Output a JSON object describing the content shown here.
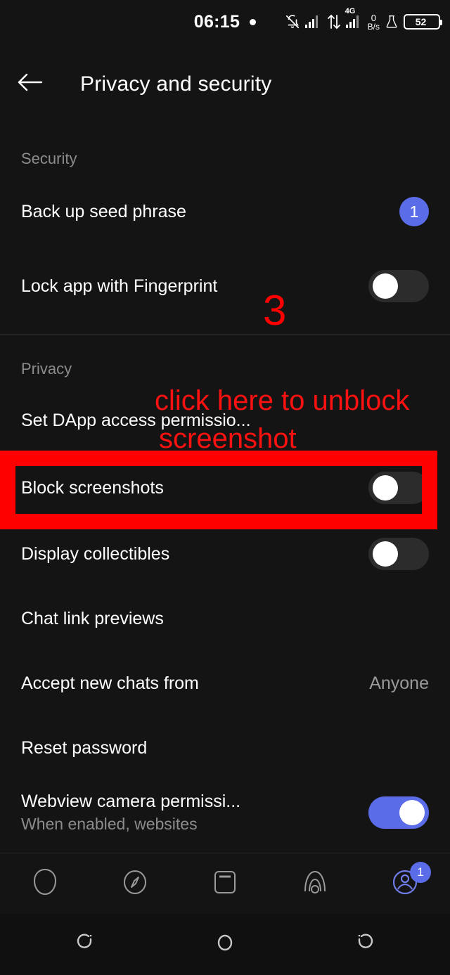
{
  "statusbar": {
    "time": "06:15",
    "dot_icon": "dot-indicator",
    "icons": [
      "notifications-off-icon",
      "signal-bars-icon",
      "data-transfer-icon",
      "4g-signal-icon",
      "flask-icon"
    ],
    "network_type": "4G",
    "data_rate_value": "0",
    "data_rate_unit": "B/s",
    "battery_percent": "52"
  },
  "header": {
    "back_icon": "back-arrow-icon",
    "title": "Privacy and security"
  },
  "sections": [
    {
      "label": "Security",
      "rows": [
        {
          "title": "Back up seed phrase",
          "control": "badge",
          "badge": "1"
        },
        {
          "title": "Lock app with Fingerprint",
          "control": "toggle",
          "state": "off"
        }
      ]
    },
    {
      "label": "Privacy",
      "rows": [
        {
          "title": "Set DApp access permissio...",
          "control": "none"
        },
        {
          "title": "Block screenshots",
          "control": "toggle",
          "state": "off"
        },
        {
          "title": "Display collectibles",
          "control": "toggle",
          "state": "off"
        },
        {
          "title": "Chat link previews",
          "control": "none"
        },
        {
          "title": "Accept new chats from",
          "control": "value",
          "value": "Anyone"
        },
        {
          "title": "Reset password",
          "control": "none"
        },
        {
          "title": "Webview camera permissi...",
          "subtitle": "When enabled, websites",
          "control": "toggle",
          "state": "on"
        }
      ]
    }
  ],
  "annotations": {
    "step_number": "3",
    "instruction_line1": "click here to unblock",
    "instruction_line2": "screenshot",
    "highlight_color": "#ff0000",
    "text_color": "#ff1111"
  },
  "bottomnav": {
    "items": [
      {
        "icon": "chat-bubble-icon",
        "active": false
      },
      {
        "icon": "compass-browser-icon",
        "active": false
      },
      {
        "icon": "wallet-icon",
        "active": false
      },
      {
        "icon": "communities-icon",
        "active": false
      },
      {
        "icon": "profile-icon",
        "active": true,
        "badge": "1"
      }
    ]
  },
  "sysnav": {
    "items": [
      "recents-icon",
      "home-icon",
      "back-icon"
    ]
  },
  "colors": {
    "accent": "#5b6ce8",
    "background": "#141414",
    "text_primary": "#ffffff",
    "text_secondary": "#8c8c8c"
  }
}
